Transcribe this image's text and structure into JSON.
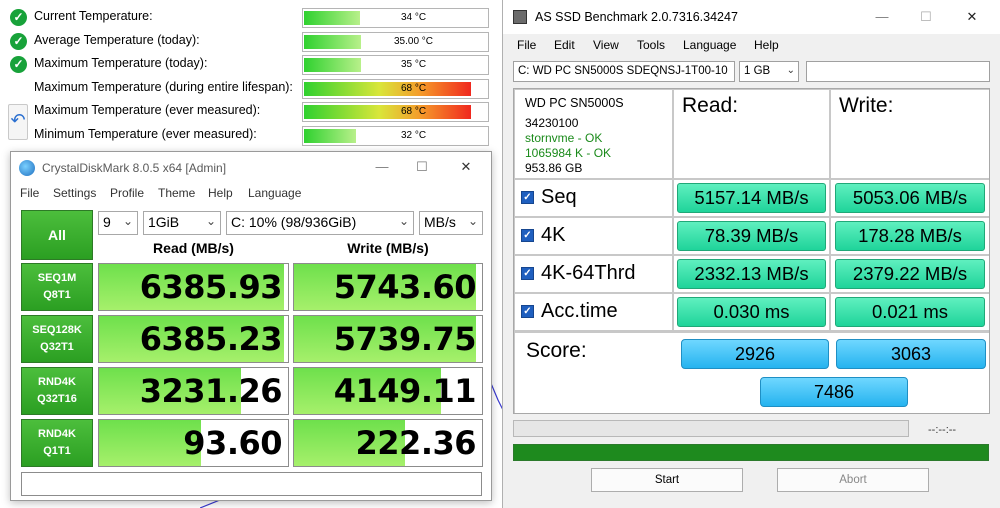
{
  "temperature_panel": {
    "rows": [
      {
        "label": "Current Temperature:",
        "value": "34 °C",
        "fill_pct": 0.3,
        "status": "ok"
      },
      {
        "label": "Average Temperature (today):",
        "value": "35.00 °C",
        "fill_pct": 0.31,
        "status": "ok"
      },
      {
        "label": "Maximum Temperature (today):",
        "value": "35 °C",
        "fill_pct": 0.31,
        "status": "ok"
      },
      {
        "label": "Maximum Temperature (during entire lifespan):",
        "value": "68 °C",
        "fill_pct": 0.9,
        "status": "none"
      },
      {
        "label": "Maximum Temperature (ever measured):",
        "value": "68 °C",
        "fill_pct": 0.9,
        "status": "none"
      },
      {
        "label": "Minimum Temperature (ever measured):",
        "value": "32 °C",
        "fill_pct": 0.28,
        "status": "none"
      }
    ],
    "colors": {
      "cool": "#2fd12f",
      "hot": "#f0281e",
      "ok_icon": "#18a23a"
    }
  },
  "crystaldiskmark": {
    "title": "CrystalDiskMark 8.0.5 x64 [Admin]",
    "menu": [
      "File",
      "Settings",
      "Profile",
      "Theme",
      "Help",
      "Language"
    ],
    "all_label": "All",
    "count": "9",
    "size": "1GiB",
    "drive": "C: 10% (98/936GiB)",
    "unit": "MB/s",
    "read_header": "Read (MB/s)",
    "write_header": "Write (MB/s)",
    "tests": [
      {
        "line1": "SEQ1M",
        "line2": "Q8T1",
        "read": "6385.93",
        "write": "5743.60",
        "read_fill": 0.98,
        "write_fill": 0.97
      },
      {
        "line1": "SEQ128K",
        "line2": "Q32T1",
        "read": "6385.23",
        "write": "5739.75",
        "read_fill": 0.98,
        "write_fill": 0.97
      },
      {
        "line1": "RND4K",
        "line2": "Q32T16",
        "read": "3231.26",
        "write": "4149.11",
        "read_fill": 0.75,
        "write_fill": 0.78
      },
      {
        "line1": "RND4K",
        "line2": "Q1T1",
        "read": "93.60",
        "write": "222.36",
        "read_fill": 0.54,
        "write_fill": 0.59
      }
    ],
    "comment": ""
  },
  "asssd": {
    "title": "AS SSD Benchmark 2.0.7316.34247",
    "menu": [
      "File",
      "Edit",
      "View",
      "Tools",
      "Language",
      "Help"
    ],
    "drive_select": "C: WD PC SN5000S SDEQNSJ-1T00-10",
    "size_select": "1 GB",
    "info": {
      "model": "WD PC SN5000S",
      "firmware": "34230100",
      "driver": "stornvme - OK",
      "alignment": "1065984 K - OK",
      "capacity": "953.86 GB"
    },
    "read_header": "Read:",
    "write_header": "Write:",
    "rows": [
      {
        "label": "Seq",
        "read": "5157.14 MB/s",
        "write": "5053.06 MB/s"
      },
      {
        "label": "4K",
        "read": "78.39 MB/s",
        "write": "178.28 MB/s"
      },
      {
        "label": "4K-64Thrd",
        "read": "2332.13 MB/s",
        "write": "2379.22 MB/s"
      },
      {
        "label": "Acc.time",
        "read": "0.030 ms",
        "write": "0.021 ms"
      }
    ],
    "score_label": "Score:",
    "score_read": "2926",
    "score_write": "3063",
    "score_total": "7486",
    "time_readout": "--:--:--",
    "progress": 1.0,
    "start_label": "Start",
    "abort_label": "Abort"
  }
}
